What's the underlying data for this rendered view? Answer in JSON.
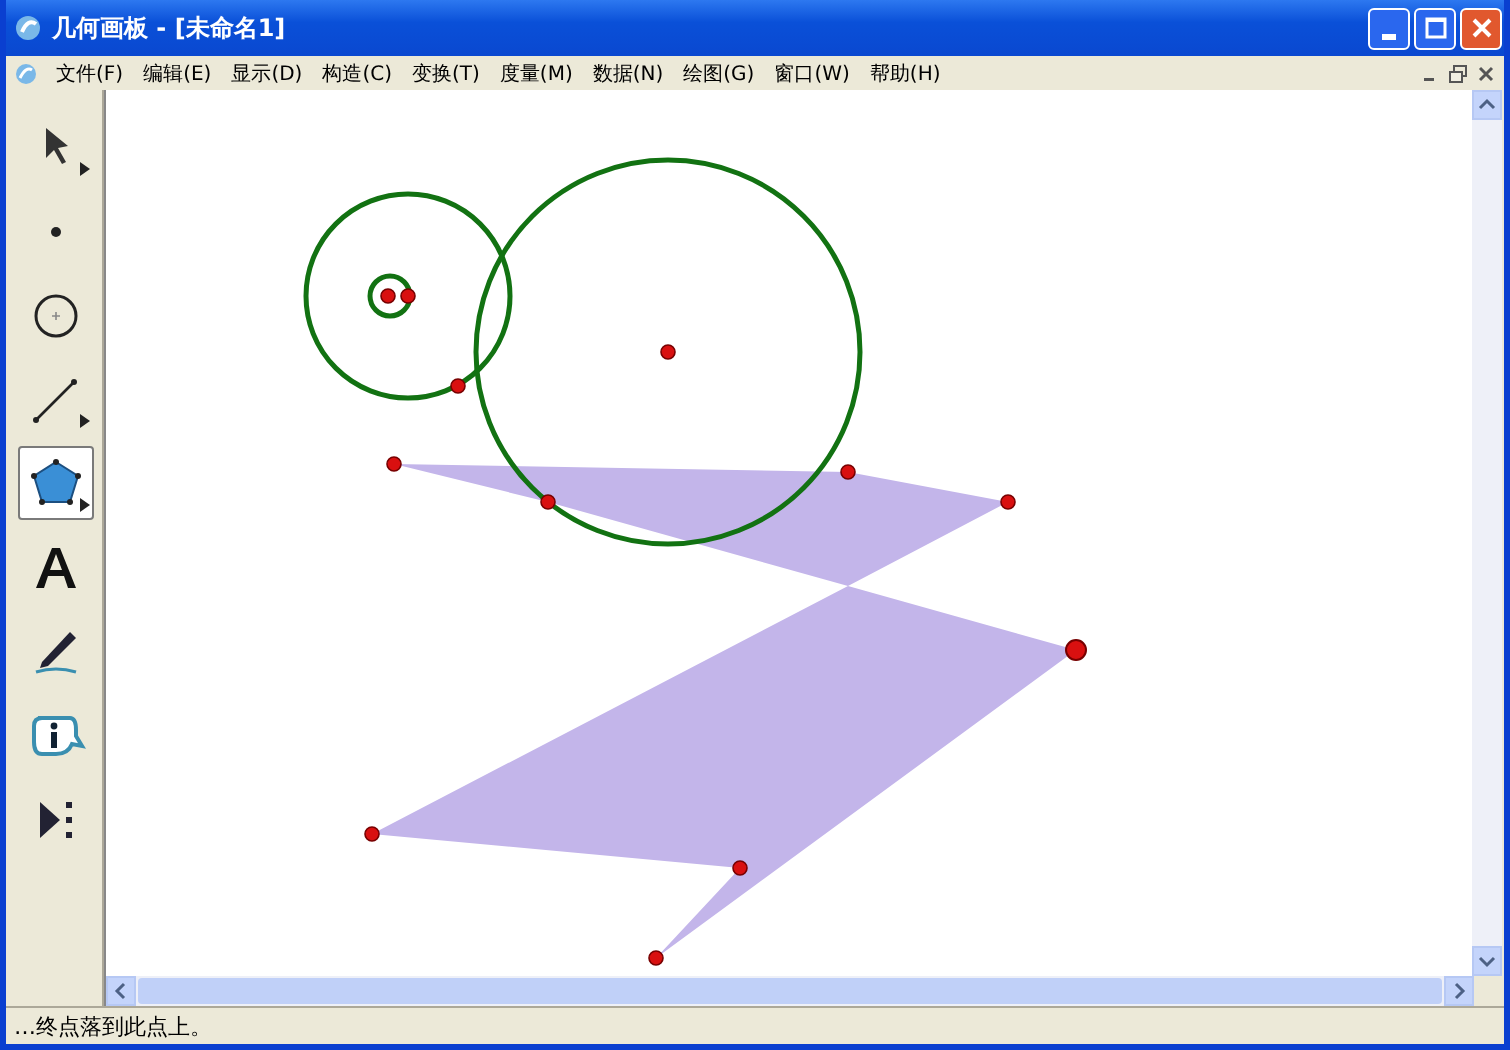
{
  "window": {
    "title": "几何画板 - [未命名1]"
  },
  "menu": [
    "文件(F)",
    "编辑(E)",
    "显示(D)",
    "构造(C)",
    "变换(T)",
    "度量(M)",
    "数据(N)",
    "绘图(G)",
    "窗口(W)",
    "帮助(H)"
  ],
  "tools": [
    {
      "kind": "arrow",
      "selected": false,
      "submenu": true
    },
    {
      "kind": "point",
      "selected": false,
      "submenu": false
    },
    {
      "kind": "compass",
      "selected": false,
      "submenu": false
    },
    {
      "kind": "line",
      "selected": false,
      "submenu": true
    },
    {
      "kind": "polygon",
      "selected": true,
      "submenu": true
    },
    {
      "kind": "text",
      "selected": false,
      "submenu": false
    },
    {
      "kind": "marker",
      "selected": false,
      "submenu": false
    },
    {
      "kind": "info",
      "selected": false,
      "submenu": false
    },
    {
      "kind": "custom",
      "selected": false,
      "submenu": false
    }
  ],
  "status_bar": "…终点落到此点上。"
}
